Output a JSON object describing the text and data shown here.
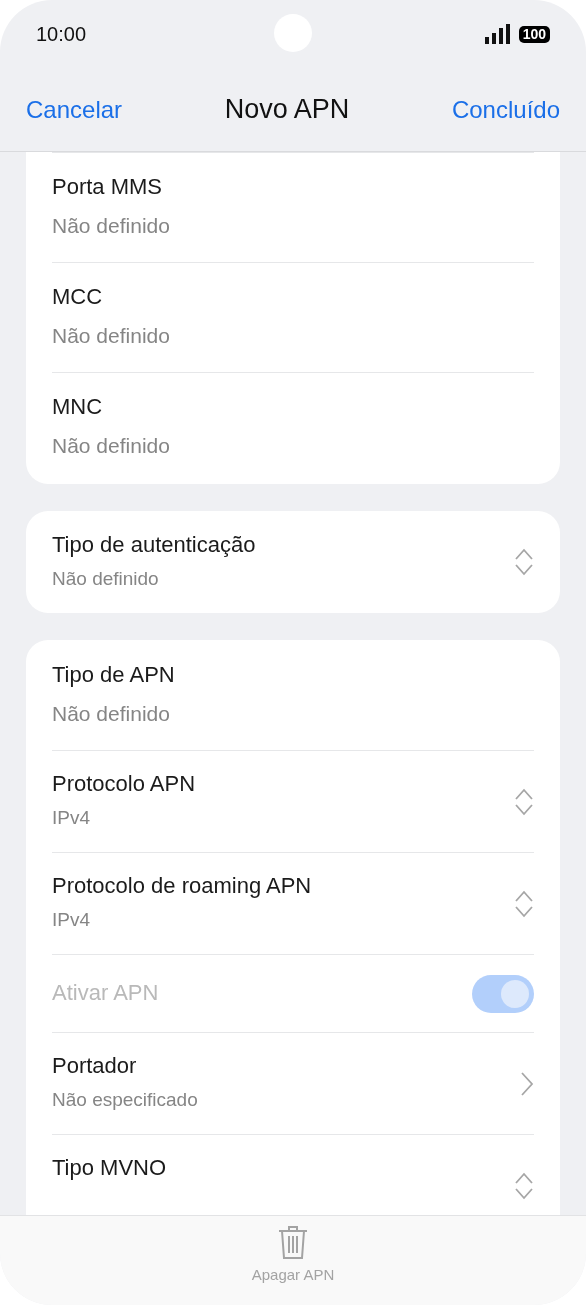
{
  "status_bar": {
    "time": "10:00",
    "battery": "100"
  },
  "header": {
    "cancel": "Cancelar",
    "title": "Novo APN",
    "done": "Concluído"
  },
  "groups": [
    {
      "cut_top": true,
      "rows": [
        {
          "kind": "text",
          "title": "Porta MMS",
          "value": "Não definido"
        },
        {
          "kind": "text",
          "title": "MCC",
          "value": "Não definido"
        },
        {
          "kind": "text",
          "title": "MNC",
          "value": "Não definido"
        }
      ]
    },
    {
      "cut_top": false,
      "rows": [
        {
          "kind": "select",
          "title": "Tipo de autenticação",
          "value": "Não definido"
        }
      ]
    },
    {
      "cut_top": false,
      "rows": [
        {
          "kind": "text",
          "title": "Tipo de APN",
          "value": "Não definido"
        },
        {
          "kind": "select",
          "title": "Protocolo APN",
          "value": "IPv4"
        },
        {
          "kind": "select",
          "title": "Protocolo de roaming APN",
          "value": "IPv4"
        },
        {
          "kind": "toggle",
          "title": "Ativar APN",
          "on": true,
          "disabled": true
        },
        {
          "kind": "link",
          "title": "Portador",
          "value": "Não especificado"
        },
        {
          "kind": "select",
          "title": "Tipo MVNO"
        }
      ]
    }
  ],
  "bottom_bar": {
    "action": "Apagar APN",
    "disabled": true
  }
}
